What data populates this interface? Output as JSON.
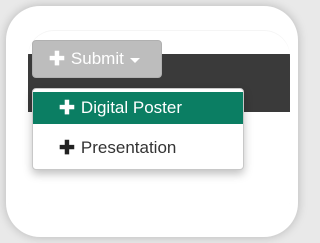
{
  "colors": {
    "navbar": "#3a3a3a",
    "button": "#bdbdbd",
    "active_item": "#0b7e63"
  },
  "submit": {
    "label": "Submit",
    "icon": "plus-icon",
    "caret_icon": "caret-down-icon"
  },
  "menu": {
    "items": [
      {
        "label": "Digital Poster",
        "icon": "plus-icon",
        "active": true
      },
      {
        "label": "Presentation",
        "icon": "plus-icon",
        "active": false
      }
    ]
  }
}
